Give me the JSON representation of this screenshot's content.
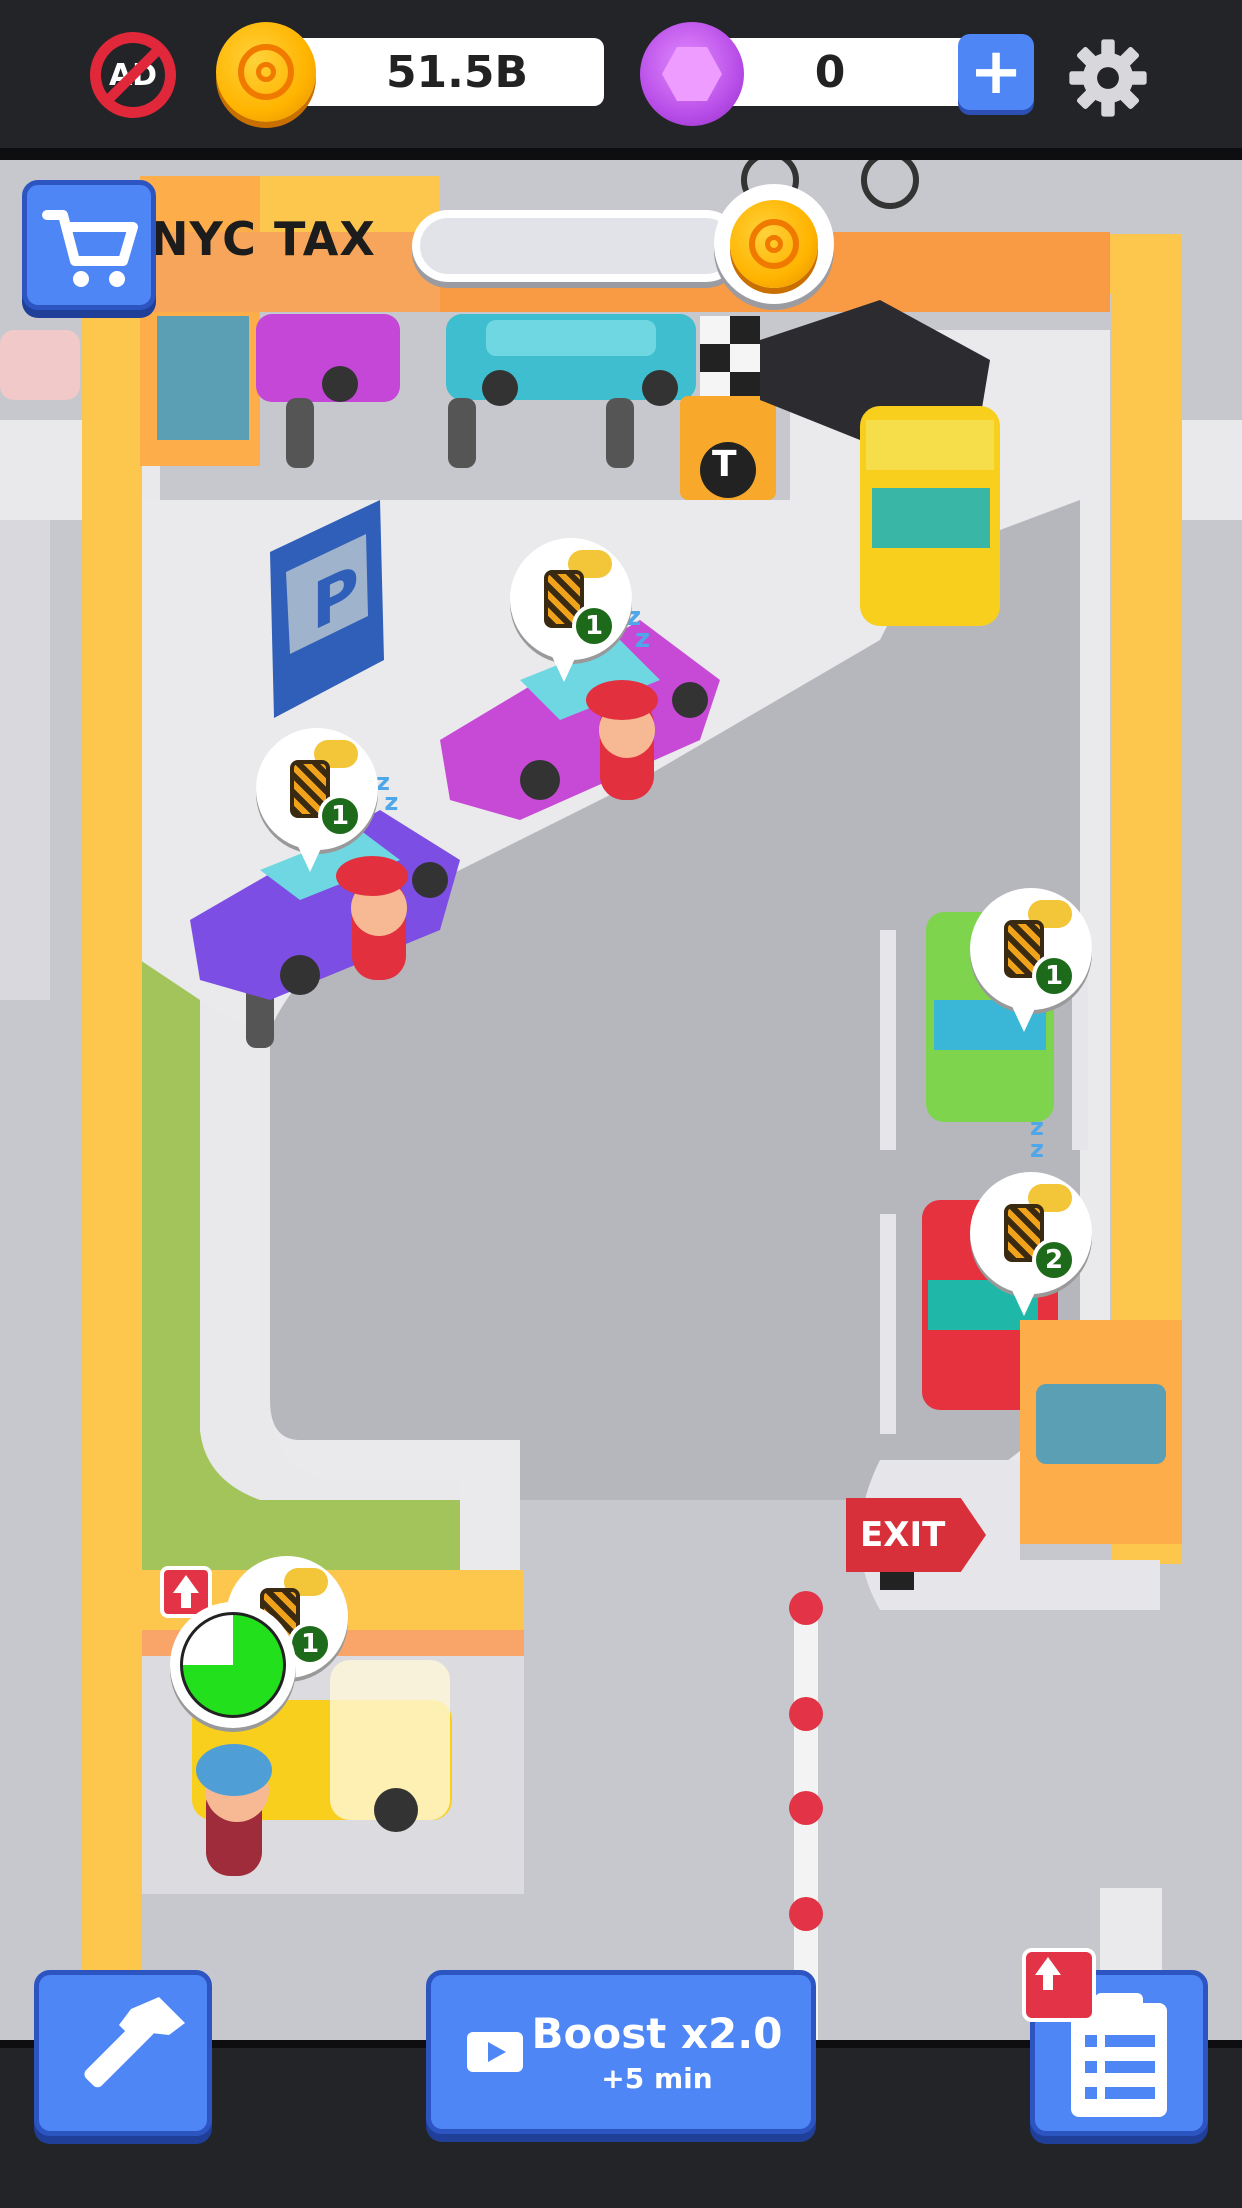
{
  "hud": {
    "no_ads_label": "AD",
    "coins": "51.5B",
    "gems": "0",
    "add_gems_label": "+"
  },
  "depot": {
    "logo": "NYC TAX",
    "sign_letter": "T",
    "parking_letter": "P",
    "progress_fraction": 0
  },
  "cars": [
    {
      "id": "magenta-sedan",
      "paint_needed": "1",
      "status": "sleeping"
    },
    {
      "id": "purple-sedan",
      "paint_needed": "1",
      "status": "sleeping"
    },
    {
      "id": "green-car",
      "paint_needed": "1",
      "status": "sleeping"
    },
    {
      "id": "red-car",
      "paint_needed": "2",
      "status": "waiting"
    },
    {
      "id": "paint-shop-car",
      "paint_needed": "1",
      "status": "painting"
    }
  ],
  "paint_shop": {
    "timer_fraction": 0.75
  },
  "exit_label": "EXIT",
  "buttons": {
    "boost_title": "Boost x2.0",
    "boost_subtitle": "+5 min"
  },
  "colors": {
    "accent_blue": "#4e86f6",
    "road_yellow": "#fcc74c",
    "taxi_yellow": "#f8cf1c",
    "exit_red": "#d8303a"
  }
}
